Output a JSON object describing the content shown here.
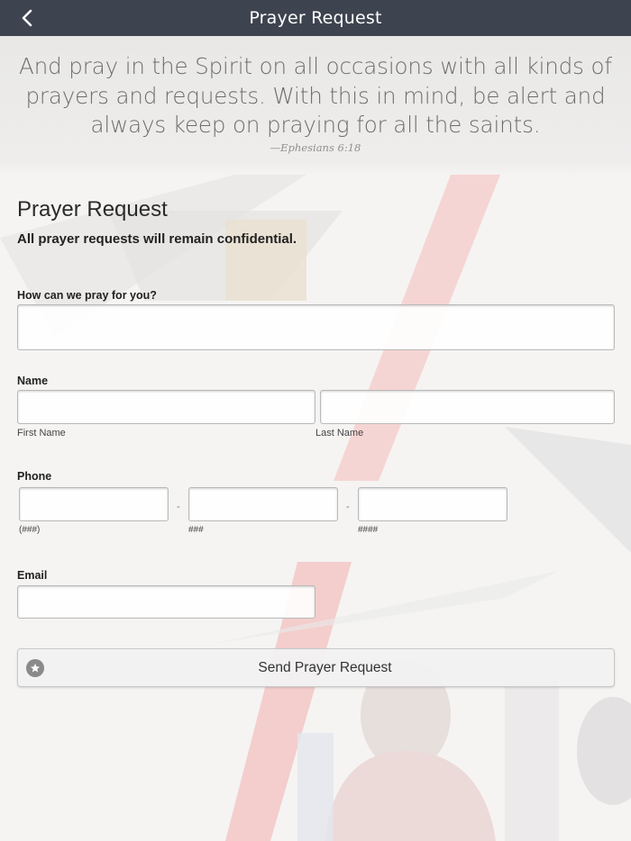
{
  "nav": {
    "title": "Prayer Request",
    "back_icon": "chevron-left-icon"
  },
  "quote": {
    "text": "And pray in the Spirit on all occasions with all kinds of prayers and requests. With this in mind, be alert and always keep on praying for all the saints.",
    "reference": "—Ephesians 6:18"
  },
  "form": {
    "title": "Prayer Request",
    "subtitle": "All prayer requests will remain confidential.",
    "prayer": {
      "label": "How can we pray for you?",
      "value": ""
    },
    "name": {
      "label": "Name",
      "first_label": "First Name",
      "last_label": "Last Name",
      "first_value": "",
      "last_value": ""
    },
    "phone": {
      "label": "Phone",
      "area_label": "(###)",
      "prefix_label": "###",
      "line_label": "####",
      "separator": "-"
    },
    "email": {
      "label": "Email",
      "value": ""
    },
    "submit": {
      "label": "Send Prayer Request",
      "icon": "star-icon"
    }
  },
  "colors": {
    "navbar": "#3e4350",
    "accent_red": "#d93a3a",
    "button_icon": "#8a8a8a"
  }
}
